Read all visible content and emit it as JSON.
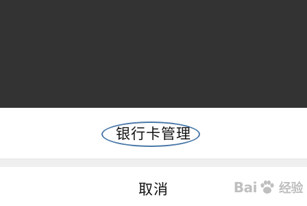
{
  "action_sheet": {
    "items": [
      {
        "label": "银行卡管理",
        "highlighted": true
      }
    ],
    "cancel_label": "取消"
  },
  "watermark": {
    "text_left": "Bai",
    "text_right": "经验"
  },
  "colors": {
    "overlay": "#333333",
    "sheet_background": "#ffffff",
    "separator": "#efeff0",
    "highlight_ellipse": "#4a78a8",
    "text": "#111111"
  },
  "icons": {
    "watermark_logo": "paw-icon"
  }
}
